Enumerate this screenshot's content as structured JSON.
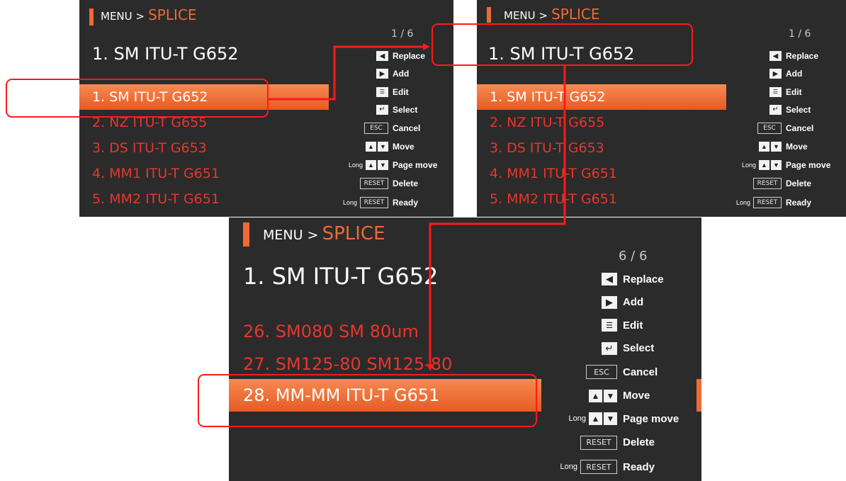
{
  "breadcrumb": {
    "menu": "MENU >",
    "section": "SPLICE"
  },
  "screens": [
    {
      "page": "1 / 6",
      "selected_title": "1. SM ITU-T G652",
      "items": [
        "1. SM ITU-T G652",
        "2. NZ ITU-T G655",
        "3. DS ITU-T G653",
        "4. MM1 ITU-T G651",
        "5. MM2 ITU-T G651"
      ],
      "highlighted": 0
    },
    {
      "page": "1 / 6",
      "selected_title": "1. SM ITU-T G652",
      "items": [
        "1. SM ITU-T G652",
        "2. NZ ITU-T G655",
        "3. DS ITU-T G653",
        "4. MM1 ITU-T G651",
        "5. MM2 ITU-T G651"
      ],
      "highlighted": 0
    },
    {
      "page": "6 / 6",
      "selected_title": "1. SM ITU-T G652",
      "items": [
        "26. SM080 SM 80um",
        "27. SM125-80 SM125-80",
        "28. MM-MM ITU-T G651"
      ],
      "highlighted": 2
    }
  ],
  "help": [
    {
      "key": "left-arrow",
      "label": "Replace"
    },
    {
      "key": "right-arrow",
      "label": "Add"
    },
    {
      "key": "edit",
      "label": "Edit"
    },
    {
      "key": "enter",
      "label": "Select"
    },
    {
      "key": "ESC",
      "label": "Cancel"
    },
    {
      "key": "up-down",
      "label": "Move"
    },
    {
      "key": "up-down",
      "long": "Long",
      "label": "Page move"
    },
    {
      "key": "RESET",
      "label": "Delete"
    },
    {
      "key": "RESET",
      "long": "Long",
      "label": "Ready"
    }
  ],
  "annotation_color": "#ff1a1a",
  "accent_color": "#ee6a35",
  "list_text_color": "#e8362c"
}
